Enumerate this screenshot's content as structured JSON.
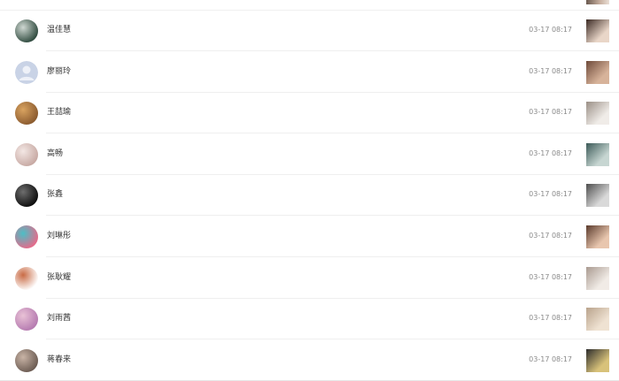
{
  "rows": [
    {
      "name": "温佳慧",
      "time": "03-17 08:17",
      "avatar_icon": "user-avatar",
      "photo_icon": "photo-thumbnail",
      "avatar_colors": [
        "#2f4a3e",
        "#cfd8d2"
      ],
      "photo_colors": [
        "#3b2a24",
        "#e9d6c8"
      ]
    },
    {
      "name": "廖丽玲",
      "time": "03-17 08:17",
      "avatar_icon": "default-avatar",
      "photo_icon": "photo-thumbnail",
      "avatar_colors": [
        "#c9d3e6",
        "#eef1f8"
      ],
      "photo_colors": [
        "#6e4a3a",
        "#d7b39a"
      ]
    },
    {
      "name": "王喆瑜",
      "time": "03-17 08:17",
      "avatar_icon": "user-avatar",
      "photo_icon": "photo-thumbnail",
      "avatar_colors": [
        "#8a5a2e",
        "#d9a360"
      ],
      "photo_colors": [
        "#9a8f86",
        "#f0ece8"
      ]
    },
    {
      "name": "高畅",
      "time": "03-17 08:17",
      "avatar_icon": "user-avatar",
      "photo_icon": "photo-thumbnail",
      "avatar_colors": [
        "#c7a9a3",
        "#f3e7e4"
      ],
      "photo_colors": [
        "#3c5a58",
        "#c7d6d2"
      ]
    },
    {
      "name": "张鑫",
      "time": "03-17 08:17",
      "avatar_icon": "user-avatar",
      "photo_icon": "photo-thumbnail",
      "avatar_colors": [
        "#0c0c0c",
        "#6e6e6e"
      ],
      "photo_colors": [
        "#4e4e4e",
        "#d9d9d9"
      ]
    },
    {
      "name": "刘琳彤",
      "time": "03-17 08:17",
      "avatar_icon": "user-avatar",
      "photo_icon": "photo-thumbnail",
      "avatar_colors": [
        "#e66a8a",
        "#4bbfc6"
      ],
      "photo_colors": [
        "#5a3a2c",
        "#e8c6ae"
      ]
    },
    {
      "name": "张耿耀",
      "time": "03-17 08:17",
      "avatar_icon": "user-avatar",
      "photo_icon": "photo-thumbnail",
      "avatar_colors": [
        "#ffffff",
        "#c96b45"
      ],
      "photo_colors": [
        "#a99a90",
        "#f1ebe6"
      ]
    },
    {
      "name": "刘雨茜",
      "time": "03-17 08:17",
      "avatar_icon": "user-avatar",
      "photo_icon": "photo-thumbnail",
      "avatar_colors": [
        "#b57ab0",
        "#e9c2d6"
      ],
      "photo_colors": [
        "#b9a38c",
        "#efe2d2"
      ]
    },
    {
      "name": "蒋春来",
      "time": "03-17 08:17",
      "avatar_icon": "user-avatar",
      "photo_icon": "photo-thumbnail",
      "avatar_colors": [
        "#6b5b52",
        "#c9b4a6"
      ],
      "photo_colors": [
        "#2c2c2c",
        "#d8c27a"
      ]
    }
  ]
}
